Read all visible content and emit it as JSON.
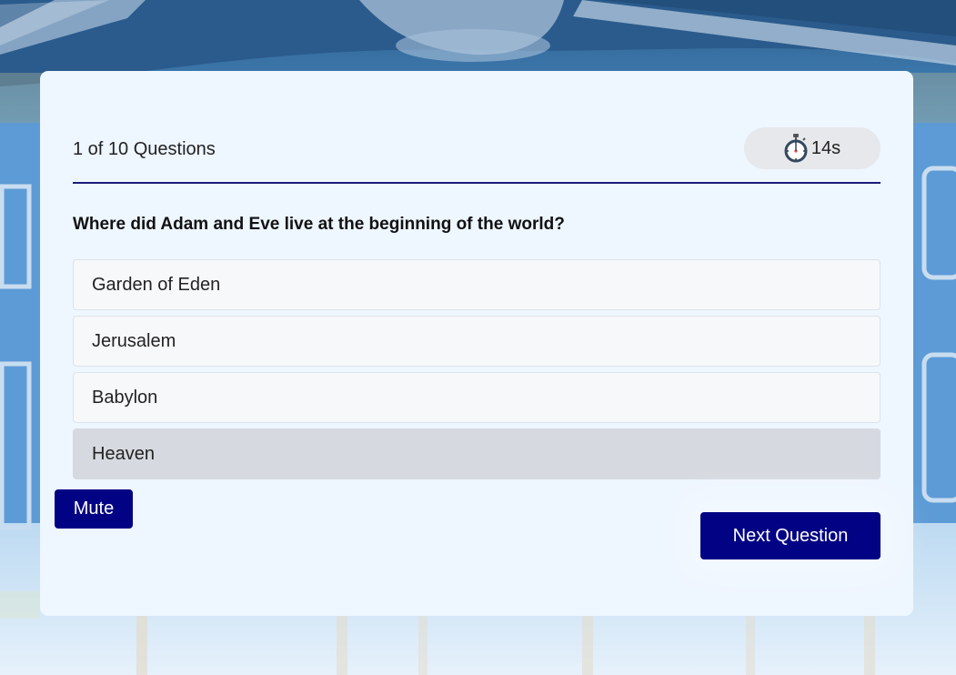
{
  "quiz": {
    "counter": "1 of 10 Questions",
    "timer": "14s",
    "timer_icon": "stopwatch-icon",
    "question": "Where did Adam and Eve live at the beginning of the world?",
    "options": [
      {
        "label": "Garden of Eden"
      },
      {
        "label": "Jerusalem"
      },
      {
        "label": "Babylon"
      },
      {
        "label": "Heaven",
        "selected": true
      }
    ]
  },
  "buttons": {
    "mute_label": "Mute",
    "next_label": "Next Question"
  },
  "colors": {
    "accent": "#020284",
    "card": "#eef6ff",
    "divider": "#1a1a7a"
  }
}
